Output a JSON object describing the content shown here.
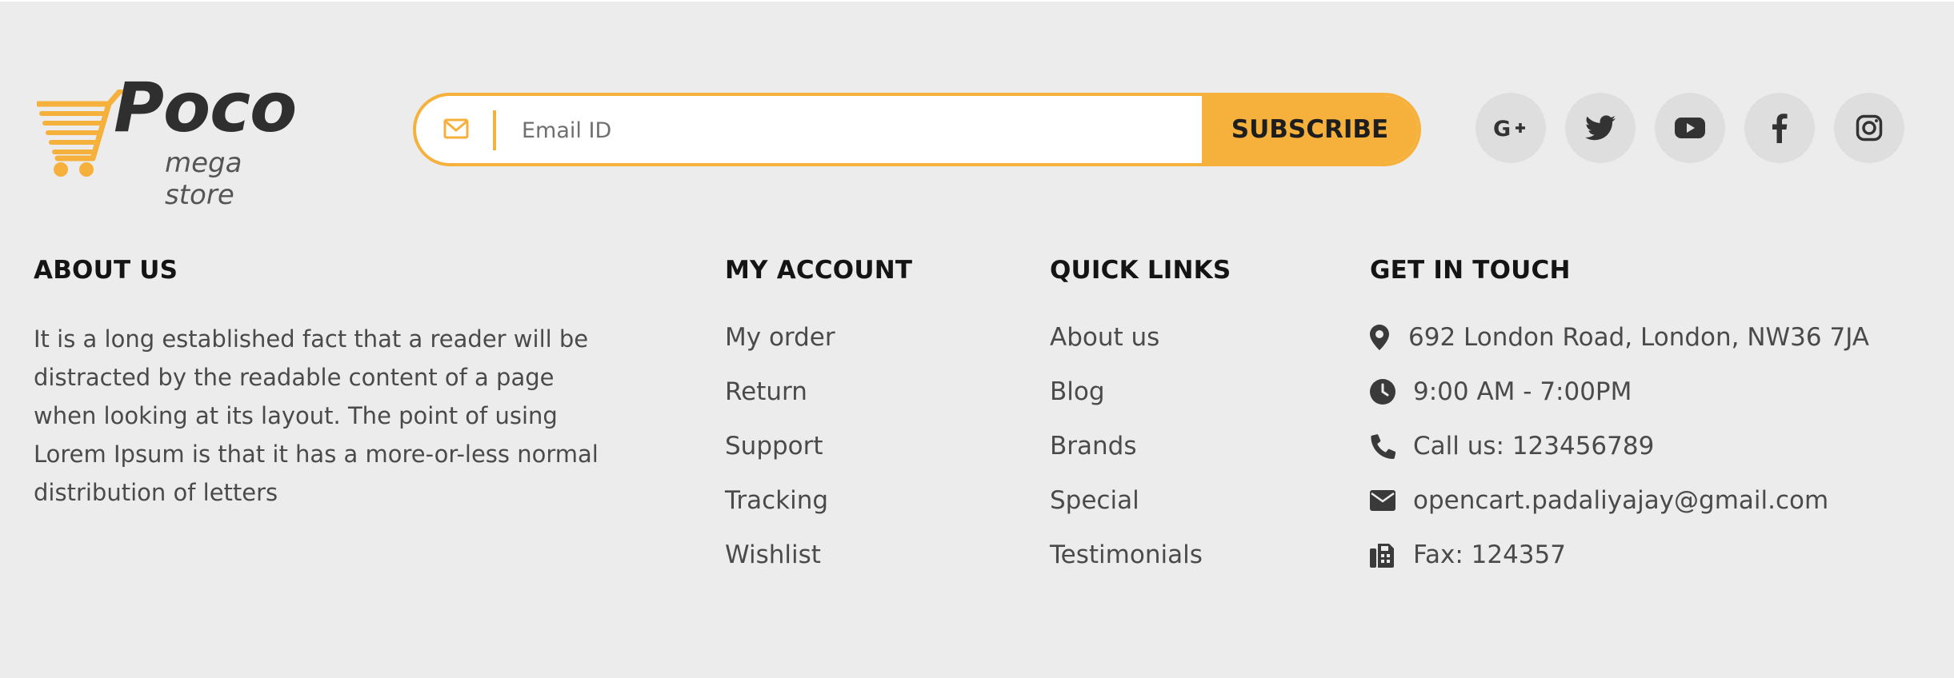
{
  "brand": {
    "name": "Poco",
    "tagline": "mega store",
    "accent_color": "#f5b13b",
    "dark_color": "#2f2f2f"
  },
  "subscribe": {
    "icon": "envelope-icon",
    "placeholder": "Email ID",
    "value": "",
    "button_label": "SUBSCRIBE"
  },
  "social": [
    {
      "name": "google-plus",
      "icon": "google-plus-icon"
    },
    {
      "name": "twitter",
      "icon": "twitter-icon"
    },
    {
      "name": "youtube",
      "icon": "youtube-icon"
    },
    {
      "name": "facebook",
      "icon": "facebook-icon"
    },
    {
      "name": "instagram",
      "icon": "instagram-icon"
    }
  ],
  "about": {
    "title": "ABOUT US",
    "text": "It is a long established fact that a reader will be distracted by the readable content of a page when looking at its layout. The point of using Lorem Ipsum is that it has a more-or-less normal distribution of letters"
  },
  "my_account": {
    "title": "MY ACCOUNT",
    "links": [
      "My order",
      "Return",
      "Support",
      "Tracking",
      "Wishlist"
    ]
  },
  "quick_links": {
    "title": "QUICK LINKS",
    "links": [
      "About us",
      "Blog",
      "Brands",
      "Special",
      "Testimonials"
    ]
  },
  "get_in_touch": {
    "title": "GET IN TOUCH",
    "items": [
      {
        "icon": "map-pin-icon",
        "text": "692 London Road, London, NW36 7JA"
      },
      {
        "icon": "clock-icon",
        "text": "9:00 AM - 7:00PM"
      },
      {
        "icon": "phone-icon",
        "text": "Call us: 123456789"
      },
      {
        "icon": "envelope-icon",
        "text": "opencart.padaliyajay@gmail.com"
      },
      {
        "icon": "fax-icon",
        "text": "Fax: 124357"
      }
    ]
  }
}
